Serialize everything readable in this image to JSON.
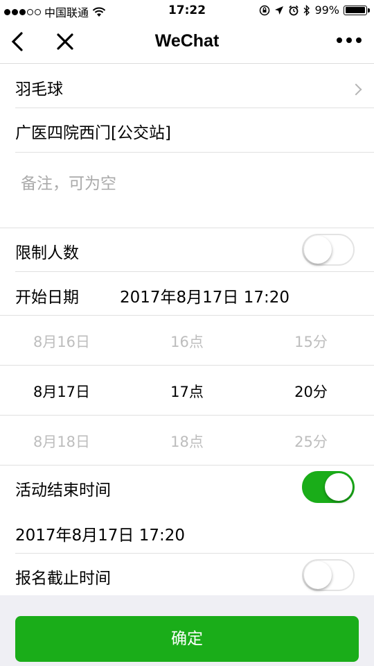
{
  "status_bar": {
    "carrier": "中国联通",
    "time": "17:22",
    "battery": "99%",
    "battery_level": 0.99
  },
  "navbar": {
    "title": "WeChat"
  },
  "form": {
    "category": "羽毛球",
    "location": "广医四院西门[公交站]",
    "note_placeholder": "备注，可为空",
    "limit_label": "限制人数",
    "limit_on": false,
    "start_label": "开始日期",
    "start_value": "2017年8月17日 17:20",
    "picker": {
      "rows": [
        {
          "day": "8月16日",
          "hour": "16点",
          "minute": "15分"
        },
        {
          "day": "8月17日",
          "hour": "17点",
          "minute": "20分"
        },
        {
          "day": "8月18日",
          "hour": "18点",
          "minute": "25分"
        }
      ],
      "selected_index": 1
    },
    "end_label": "活动结束时间",
    "end_on": true,
    "end_value": "2017年8月17日 17:20",
    "deadline_label": "报名截止时间",
    "deadline_on": false
  },
  "confirm_button": "确定",
  "colors": {
    "accent": "#1aad19"
  }
}
